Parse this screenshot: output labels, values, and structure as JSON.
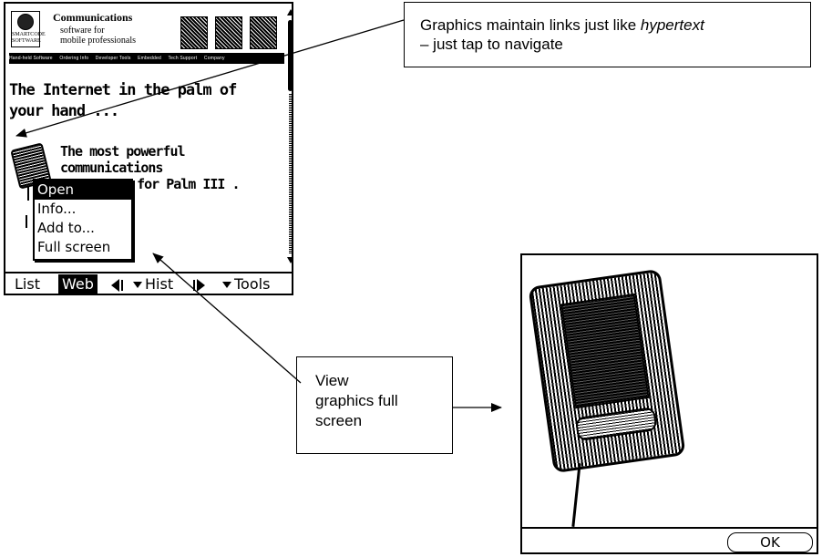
{
  "palm_browser": {
    "banner": {
      "logo_text": "SMARTCODE",
      "logo_subtext": "SOFTWARE",
      "title": "Communications",
      "subtitle_line1": "software for",
      "subtitle_line2": "mobile professionals"
    },
    "nav_links": [
      "Hand-held Software",
      "Ordering Info",
      "Developer Tools",
      "Embedded",
      "Tech Support",
      "Company"
    ],
    "headline_line1": "The Internet in the palm of",
    "headline_line2": "your hand ...",
    "subhead_line1": "The most powerful",
    "subhead_line2": "communications",
    "subhead_line3": "re for Palm III ."
  },
  "context_menu": {
    "items": [
      "Open",
      "Info...",
      "Add to...",
      "Full screen"
    ],
    "selected": "Open"
  },
  "toolbar": {
    "list_label": "List",
    "web_label": "Web",
    "hist_label": "Hist",
    "tools_label": "Tools"
  },
  "callouts": {
    "links_line1_plain": "Graphics maintain links just like ",
    "links_line1_italic": "hypertext",
    "links_line2": "– just tap to navigate",
    "fullscreen_line1": "View",
    "fullscreen_line2": "graphics full",
    "fullscreen_line3": "screen"
  },
  "fullscreen_view": {
    "ok_label": "OK"
  }
}
